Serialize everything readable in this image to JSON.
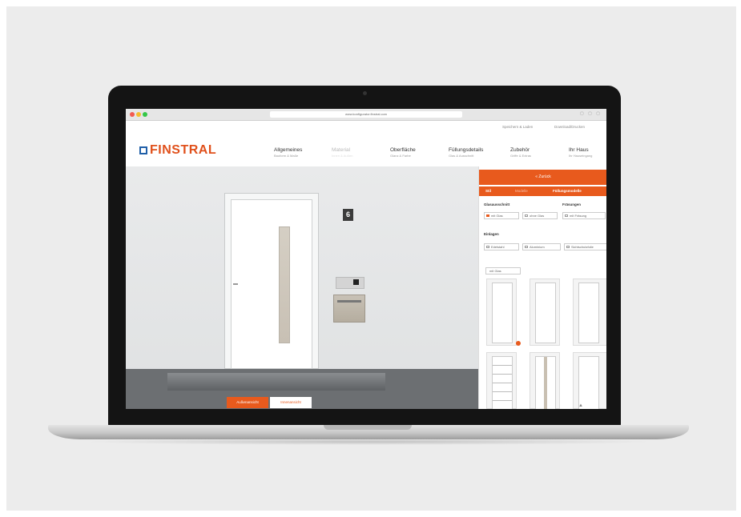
{
  "browser": {
    "url": "www.konfigurator.finstral.com"
  },
  "utility_links": [
    "Speichern & Laden",
    "Download/Drucken"
  ],
  "logo": {
    "text": "FINSTRAL",
    "colors": {
      "box": "#1f5fa8",
      "text": "#e0501b"
    }
  },
  "nav": [
    {
      "title": "Allgemeines",
      "sub": "Bauform & Maße"
    },
    {
      "title": "Material",
      "sub": "Innen & Außen"
    },
    {
      "title": "Oberfläche",
      "sub": "Glanz & Farbe"
    },
    {
      "title": "Füllungsdetails",
      "sub": "Glas & Ausschnitt"
    },
    {
      "title": "Zubehör",
      "sub": "Griffe & Extras"
    },
    {
      "title": "Ihr Haus",
      "sub": "Ihr Hauseingang"
    }
  ],
  "scene": {
    "house_number": "6",
    "view_buttons": [
      "Außenansicht",
      "Innenansicht"
    ]
  },
  "panel": {
    "back": "« Zurück",
    "tabs": [
      "Stil",
      "Modelle",
      "Füllungsmodelle"
    ],
    "groups": [
      {
        "label": "Glasausschnitt",
        "options": [
          "mit Glas",
          "ohne Glas"
        ]
      },
      {
        "label": "Fräsungen",
        "options": [
          "mit Fräsung"
        ]
      },
      {
        "label": "Einlagen",
        "options": [
          "Edelstahl",
          "Aluminium",
          "Sichtschutzfolie"
        ]
      }
    ],
    "filter": "mit Glas"
  },
  "accent": "#e85a1d"
}
